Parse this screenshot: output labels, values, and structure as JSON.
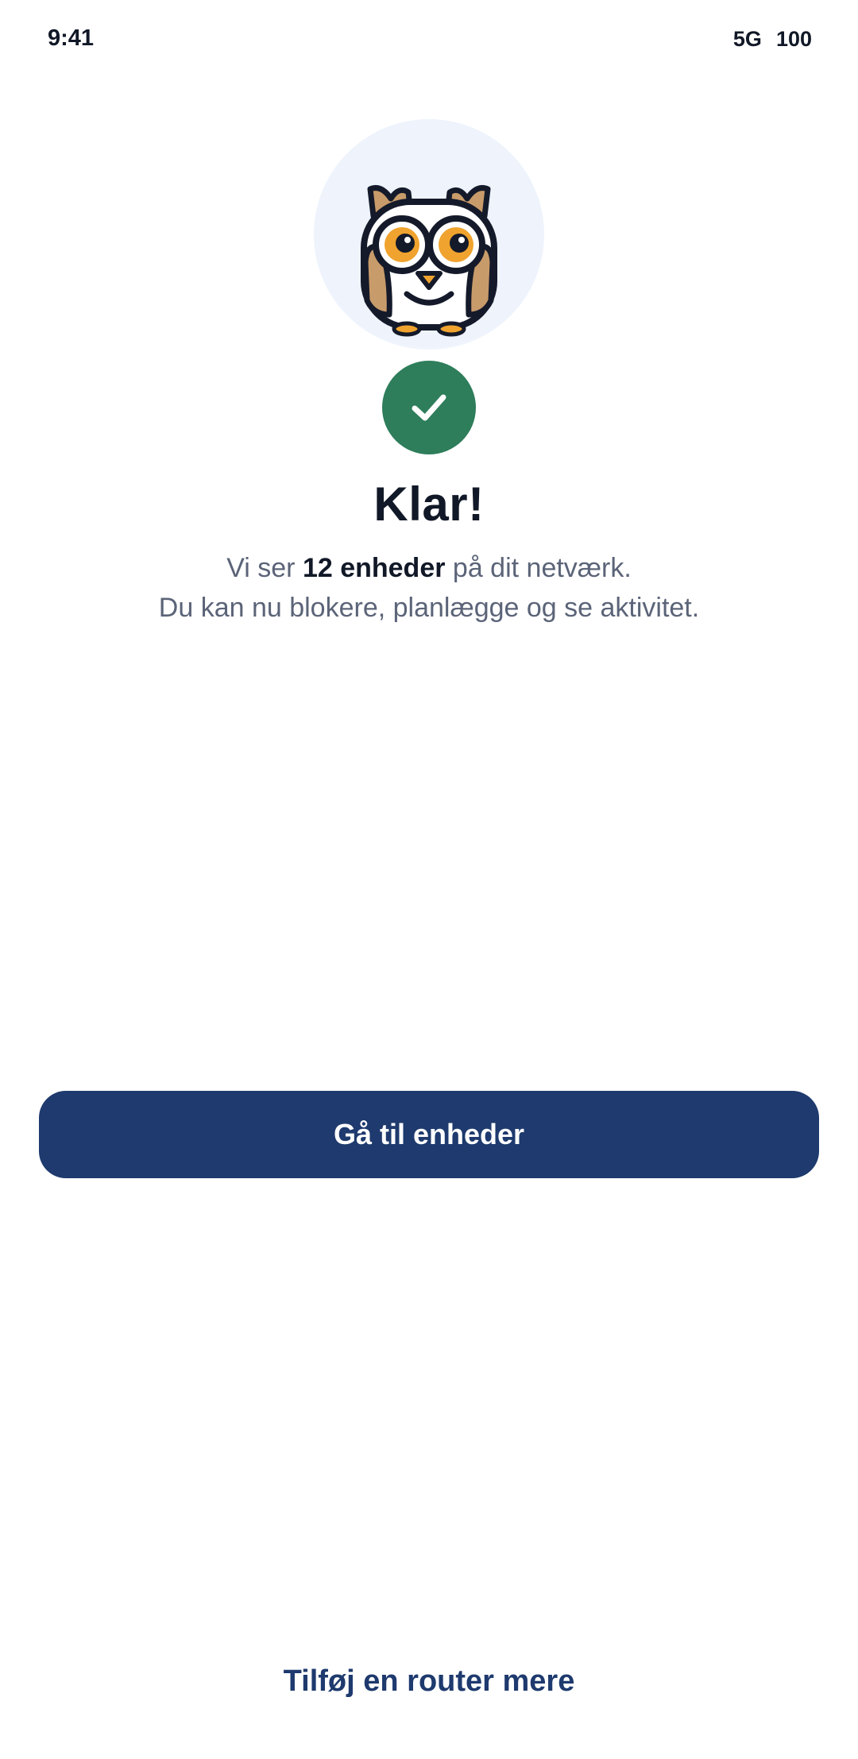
{
  "status_bar": {
    "time": "9:41",
    "network": "5G",
    "battery": "100"
  },
  "mascot": {
    "icon": "owl-mascot-icon"
  },
  "success_badge": {
    "icon": "checkmark-icon",
    "color": "#2e7d5b"
  },
  "main": {
    "title": "Klar!",
    "subtitle_prefix": "Vi ser ",
    "subtitle_highlight": "12 enheder",
    "subtitle_suffix": " på dit netværk.",
    "subtitle_line2": "Du kan nu blokere, planlægge og se aktivitet."
  },
  "actions": {
    "primary_label": "Gå til enheder",
    "secondary_label": "Tilføj en router mere"
  },
  "colors": {
    "primary": "#1e3a6e",
    "success": "#2e7d5b",
    "mascot_bg": "#eef3fc"
  }
}
